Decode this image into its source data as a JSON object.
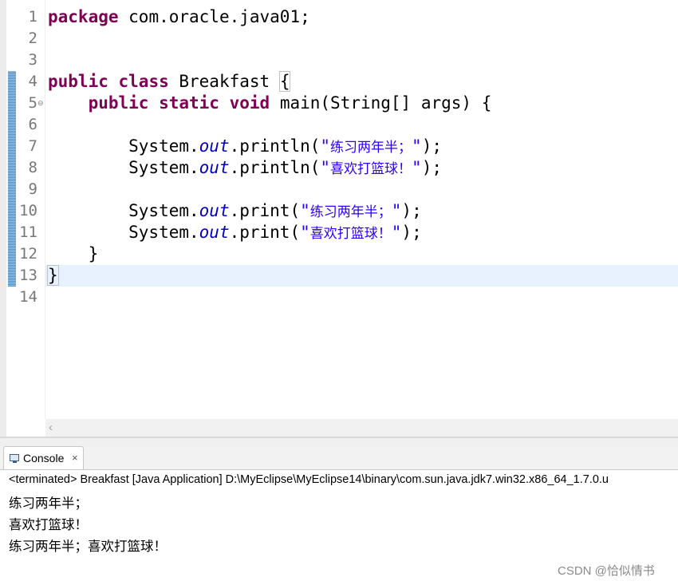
{
  "editor": {
    "lines": [
      {
        "num": "1",
        "tokens": [
          {
            "t": "package",
            "c": "kw"
          },
          {
            "t": " com.oracle.java01;",
            "c": ""
          }
        ]
      },
      {
        "num": "2",
        "tokens": []
      },
      {
        "num": "3",
        "tokens": []
      },
      {
        "num": "4",
        "tokens": [
          {
            "t": "public",
            "c": "kw"
          },
          {
            "t": " ",
            "c": ""
          },
          {
            "t": "class",
            "c": "kw"
          },
          {
            "t": " Breakfast ",
            "c": ""
          },
          {
            "t": "{",
            "c": "bracket-match"
          }
        ]
      },
      {
        "num": "5",
        "tokens": [
          {
            "t": "    ",
            "c": ""
          },
          {
            "t": "public",
            "c": "kw"
          },
          {
            "t": " ",
            "c": ""
          },
          {
            "t": "static",
            "c": "kw"
          },
          {
            "t": " ",
            "c": ""
          },
          {
            "t": "void",
            "c": "kw"
          },
          {
            "t": " main(String[] args) {",
            "c": ""
          }
        ]
      },
      {
        "num": "6",
        "tokens": []
      },
      {
        "num": "7",
        "tokens": [
          {
            "t": "        System.",
            "c": ""
          },
          {
            "t": "out",
            "c": "fld"
          },
          {
            "t": ".println(",
            "c": ""
          },
          {
            "t": "\"练习两年半；\"",
            "c": "str"
          },
          {
            "t": ");",
            "c": ""
          }
        ]
      },
      {
        "num": "8",
        "tokens": [
          {
            "t": "        System.",
            "c": ""
          },
          {
            "t": "out",
            "c": "fld"
          },
          {
            "t": ".println(",
            "c": ""
          },
          {
            "t": "\"喜欢打篮球！\"",
            "c": "str"
          },
          {
            "t": ");",
            "c": ""
          }
        ]
      },
      {
        "num": "9",
        "tokens": []
      },
      {
        "num": "10",
        "tokens": [
          {
            "t": "        System.",
            "c": ""
          },
          {
            "t": "out",
            "c": "fld"
          },
          {
            "t": ".print(",
            "c": ""
          },
          {
            "t": "\"练习两年半；\"",
            "c": "str"
          },
          {
            "t": ");",
            "c": ""
          }
        ]
      },
      {
        "num": "11",
        "tokens": [
          {
            "t": "        System.",
            "c": ""
          },
          {
            "t": "out",
            "c": "fld"
          },
          {
            "t": ".print(",
            "c": ""
          },
          {
            "t": "\"喜欢打篮球！\"",
            "c": "str"
          },
          {
            "t": ");",
            "c": ""
          }
        ]
      },
      {
        "num": "12",
        "tokens": [
          {
            "t": "    }",
            "c": ""
          }
        ]
      },
      {
        "num": "13",
        "tokens": [
          {
            "t": "}",
            "c": "bracket-match"
          }
        ],
        "current": true
      },
      {
        "num": "14",
        "tokens": []
      }
    ],
    "fold_marker_line": "5",
    "fold_icon": "collapse-icon",
    "scroll_left_icon": "chevron-left-icon"
  },
  "console": {
    "tab_label": "Console",
    "tab_close": "×",
    "tab_icon": "console-icon",
    "status": "<terminated> Breakfast [Java Application] D:\\MyEclipse\\MyEclipse14\\binary\\com.sun.java.jdk7.win32.x86_64_1.7.0.u",
    "output": [
      "练习两年半；",
      "喜欢打篮球！",
      "练习两年半；喜欢打篮球！"
    ]
  },
  "watermark": "CSDN @恰似情书",
  "colors": {
    "keyword": "#7f0055",
    "field": "#0000c0",
    "string": "#2a00ff",
    "current_line": "#e8f2fe",
    "line_number": "#787878"
  }
}
